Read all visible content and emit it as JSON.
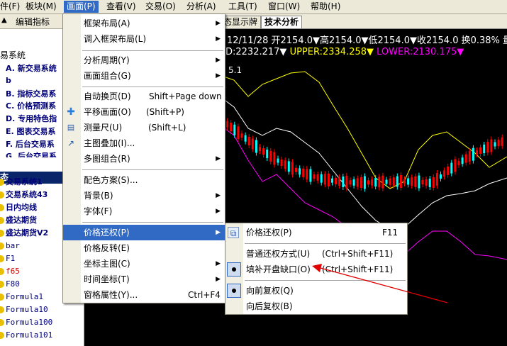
{
  "menubar": [
    {
      "label": "件(F)",
      "active": false
    },
    {
      "label": "板块(M)",
      "active": false
    },
    {
      "label": "画面(P)",
      "active": true
    },
    {
      "label": "查看(V)",
      "active": false
    },
    {
      "label": "交易(O)",
      "active": false
    },
    {
      "label": "分析(A)",
      "active": false
    },
    {
      "label": "工具(T)",
      "active": false
    },
    {
      "label": "窗口(W)",
      "active": false
    },
    {
      "label": "帮助(H)",
      "active": false
    }
  ],
  "left_panel": {
    "toolbar_label": "编辑指标",
    "tree_header": "易系统",
    "tree_items": [
      "A. 新交易系统",
      "b",
      "B. 指标交易系",
      "C. 价格预测系",
      "D. 专用特色指",
      "E. 图表交易系",
      "F. 后台交易系",
      "G. 后台交易系"
    ],
    "section_band": "态",
    "list_items": [
      {
        "label": "交易系统1",
        "bold": true,
        "color": "#00007b"
      },
      {
        "label": "交易系统43",
        "bold": true,
        "color": "#00007b"
      },
      {
        "label": "日内均线",
        "bold": true,
        "color": "#00007b"
      },
      {
        "label": "盛达期货",
        "bold": true,
        "color": "#00007b"
      },
      {
        "label": "盛达期货V2",
        "bold": true,
        "color": "#00007b"
      },
      {
        "label": "bar",
        "bold": false,
        "color": "#00007b"
      },
      {
        "label": "F1",
        "bold": false,
        "color": "#00007b"
      },
      {
        "label": "f65",
        "bold": false,
        "color": "#d40000"
      },
      {
        "label": "F80",
        "bold": false,
        "color": "#00007b"
      },
      {
        "label": "Formula1",
        "bold": false,
        "color": "#00007b"
      },
      {
        "label": "Formula10",
        "bold": false,
        "color": "#00007b"
      },
      {
        "label": "Formula100",
        "bold": false,
        "color": "#00007b"
      },
      {
        "label": "Formula101",
        "bold": false,
        "color": "#00007b"
      }
    ]
  },
  "tabs": [
    {
      "label": "态显示牌",
      "active": false
    },
    {
      "label": "技术分析",
      "active": true
    }
  ],
  "chart_info": {
    "line1": "12/11/28 开2154.0▼高2154.0▼低2154.0▼收2154.0 换0.38% 量",
    "line2_mid": "D:2232.217▼",
    "line2_upper": "UPPER:2334.258▼",
    "line2_lower": "LOWER:2130.175▼",
    "small_label": "5.1"
  },
  "main_menu": [
    {
      "label": "框架布局(A)",
      "shortcut": "",
      "submenu": true
    },
    {
      "label": "调入框架布局(L)",
      "shortcut": "",
      "submenu": true
    },
    {
      "label": "分析周期(Y)",
      "shortcut": "",
      "submenu": true
    },
    {
      "label": "画面组合(G)",
      "shortcut": "",
      "submenu": true
    },
    {
      "label": "自动换页(D)",
      "shortcut": "Shift+Page down",
      "submenu": false
    },
    {
      "label": "平移画面(O)",
      "shortcut": "(Shift+P)",
      "submenu": false,
      "icon": "pan-icon"
    },
    {
      "label": "测量尺(U)",
      "shortcut": "(Shift+L)",
      "submenu": false,
      "icon": "ruler-icon"
    },
    {
      "label": "主图叠加(I)...",
      "shortcut": "",
      "submenu": false,
      "icon": "overlay-chart-icon"
    },
    {
      "label": "多图组合(R)",
      "shortcut": "",
      "submenu": true
    },
    {
      "label": "配色方案(S)...",
      "shortcut": "",
      "submenu": false
    },
    {
      "label": "背景(B)",
      "shortcut": "",
      "submenu": true
    },
    {
      "label": "字体(F)",
      "shortcut": "",
      "submenu": true
    },
    {
      "label": "价格还权(P)",
      "shortcut": "",
      "submenu": true,
      "highlighted": true
    },
    {
      "label": "价格反转(E)",
      "shortcut": "",
      "submenu": false
    },
    {
      "label": "坐标主图(C)",
      "shortcut": "",
      "submenu": true
    },
    {
      "label": "时间坐标(T)",
      "shortcut": "",
      "submenu": true
    },
    {
      "label": "窗格属性(Y)...",
      "shortcut": "Ctrl+F4",
      "submenu": false
    }
  ],
  "sub_menu": [
    {
      "label": "价格还权(P)",
      "shortcut": "F11",
      "icon": "restore-price-icon"
    },
    {
      "label": "普通还权方式(U)",
      "shortcut": "(Ctrl+Shift+F11)"
    },
    {
      "label": "填补开盘缺口(O)",
      "shortcut": "(Ctrl+Shift+F11)",
      "checked": true
    },
    {
      "label": "向前复权(Q)",
      "shortcut": "",
      "checked": true
    },
    {
      "label": "向后复权(B)",
      "shortcut": ""
    }
  ],
  "colors": {
    "menu_highlight": "#316ac5",
    "upper_band": "#ffff00",
    "lower_band": "#ff00ff",
    "mid_band": "#ffffff",
    "candle_up": "#ff0000",
    "candle_down": "#00ffff",
    "annotation_arrow": "#e00000"
  }
}
